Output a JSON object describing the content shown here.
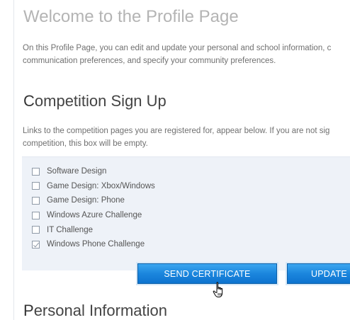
{
  "welcome": {
    "title": "Welcome to the Profile Page",
    "description": "On this Profile Page, you can edit and update your personal and school information, c",
    "description_line2": "communication preferences, and specify your community preferences."
  },
  "competition": {
    "heading_first": "C",
    "heading_rest": "ompetition Sign Up",
    "description": "Links to the competition pages you are registered for, appear below. If you are not sig",
    "description_line2": "competition, this box will be empty.",
    "items": [
      {
        "label": "Software Design",
        "checked": false
      },
      {
        "label": "Game Design: Xbox/Windows",
        "checked": false
      },
      {
        "label": "Game Design: Phone",
        "checked": false
      },
      {
        "label": "Windows Azure Challenge",
        "checked": false
      },
      {
        "label": "IT Challenge",
        "checked": false
      },
      {
        "label": "Windows Phone Challenge",
        "checked": true
      }
    ],
    "send_button": "SEND CERTIFICATE",
    "update_button": "UPDATE"
  },
  "personal": {
    "heading_first": "P",
    "heading_rest": "ersonal Information"
  },
  "colors": {
    "button_blue": "#1b86dd",
    "panel_bg": "#eef2f8"
  },
  "icons": {
    "cursor": "hand-pointer-icon"
  }
}
